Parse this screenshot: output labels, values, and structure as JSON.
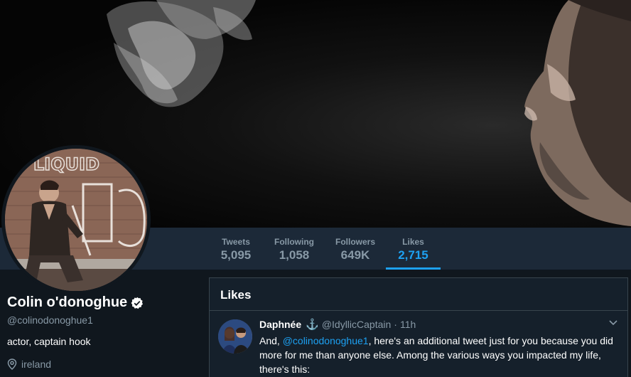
{
  "profile": {
    "name": "Colin o'donoghue",
    "handle": "@colinodonoghue1",
    "bio": "actor, captain hook",
    "location": "ireland",
    "avatar_sign_text": "LIQUID"
  },
  "stats": {
    "tweets": {
      "label": "Tweets",
      "value": "5,095"
    },
    "following": {
      "label": "Following",
      "value": "1,058"
    },
    "followers": {
      "label": "Followers",
      "value": "649K"
    },
    "likes": {
      "label": "Likes",
      "value": "2,715"
    }
  },
  "likes_panel": {
    "title": "Likes",
    "tweet": {
      "name": "Daphnée",
      "anchor": "⚓",
      "handle": "@IdyllicCaptain",
      "dot": "·",
      "time": "11h",
      "text_prefix": "And, ",
      "mention": "@colinodonoghue1",
      "text_rest": ", here's an additional tweet just for you because you did more for me than anyone else. Among the various ways you impacted my life, there's this:"
    }
  },
  "colors": {
    "accent": "#1da1f2",
    "background": "#10171e",
    "stats_bar": "#1c2938",
    "secondary_text": "#8899a6"
  },
  "icons": {
    "verified": "verified-badge-icon",
    "location": "location-pin-icon",
    "chevron": "chevron-down-icon"
  }
}
